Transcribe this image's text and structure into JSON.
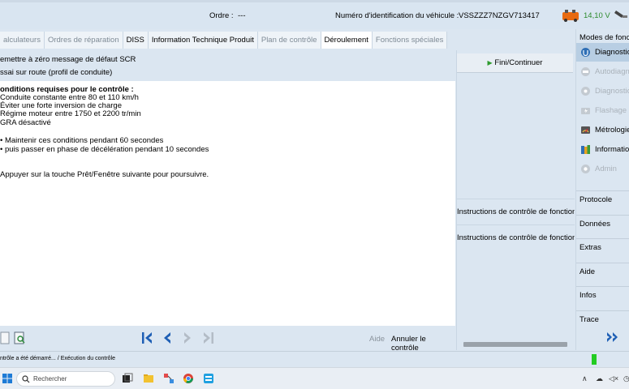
{
  "header": {
    "order_label": "Ordre :",
    "order_value": "---",
    "vin_label": "Numéro d'identification du véhicule :",
    "vin_value": "VSSZZZ7NZGV713417",
    "voltage": "14,10 V"
  },
  "tabs": [
    {
      "label": "alculateurs",
      "state": "inactive"
    },
    {
      "label": "Ordres de réparation",
      "state": "inactive"
    },
    {
      "label": "DISS",
      "state": "active"
    },
    {
      "label": "Information Technique Produit",
      "state": "active"
    },
    {
      "label": "Plan de contrôle",
      "state": "inactive"
    },
    {
      "label": "Déroulement",
      "state": "current"
    },
    {
      "label": "Fonctions spéciales",
      "state": "inactive"
    }
  ],
  "test": {
    "title_line1": "emettre à zéro message de défaut SCR",
    "title_line2": "ssai sur route (profil de conduite)",
    "conditions_heading": "onditions requises pour le contrôle :",
    "conditions": [
      "Conduite constante entre 80 et 110 km/h",
      "Éviter une forte inversion de charge",
      "Régime moteur entre 1750 et 2200 tr/min",
      "GRA désactivé"
    ],
    "steps": [
      "• Maintenir ces conditions pendant 60 secondes",
      "• puis passer en phase de décélération pendant 10 secondes"
    ],
    "instruction": "Appuyer sur la touche Prêt/Fenêtre suivante pour poursuivre."
  },
  "bottom": {
    "help": "Aide",
    "cancel": "Annuler le contrôle"
  },
  "right_panel": {
    "finish": "Fini/Continuer",
    "instructions": [
      "Instructions de contrôle de fonction",
      "Instructions de contrôle de fonction"
    ]
  },
  "sidebar": {
    "title": "Modes de fonct",
    "modes": [
      {
        "label": "Diagnostic",
        "icon": "stethoscope-icon",
        "state": "selected"
      },
      {
        "label": "Autodiagn",
        "icon": "car-diagnosis-icon",
        "state": "disabled"
      },
      {
        "label": "Diagnostic",
        "icon": "ecu-icon",
        "state": "disabled"
      },
      {
        "label": "Flashage",
        "icon": "flash-icon",
        "state": "disabled"
      },
      {
        "label": "Métrologie",
        "icon": "multimeter-icon",
        "state": "enabled"
      },
      {
        "label": "Information",
        "icon": "books-icon",
        "state": "enabled"
      },
      {
        "label": "Admin",
        "icon": "admin-icon",
        "state": "disabled"
      }
    ],
    "sections": [
      "Protocole",
      "Données",
      "Extras",
      "Aide",
      "Infos",
      "Trace"
    ]
  },
  "status": {
    "text": "ntrôle a été démarré... / Exécution du contrôle"
  },
  "taskbar": {
    "search_placeholder": "Rechercher"
  },
  "colors": {
    "panel_bg": "#dbe6f1",
    "selected_bg": "#b8cee3",
    "nav_blue": "#1e5fb5",
    "voltage_green": "#2e8b2e",
    "status_green": "#22cc22"
  }
}
